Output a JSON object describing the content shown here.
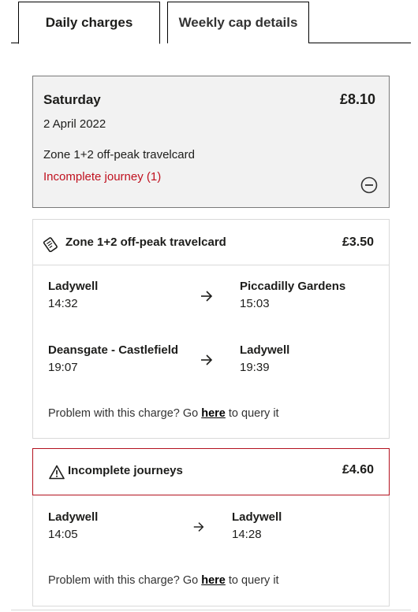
{
  "tabs": [
    {
      "label": "Daily charges",
      "active": true
    },
    {
      "label": "Weekly cap details",
      "active": false
    }
  ],
  "summary": {
    "day": "Saturday",
    "date": "2 April 2022",
    "total": "£8.10",
    "product": "Zone 1+2 off-peak travelcard",
    "incomplete_label": "Incomplete journey (1)",
    "collapse_icon": "minus-circle-icon"
  },
  "travelcard_charge": {
    "icon": "ticket-icon",
    "title": "Zone 1+2 off-peak travelcard",
    "amount": "£3.50",
    "journeys": [
      {
        "from": "Ladywell",
        "from_time": "14:32",
        "to": "Piccadilly Gardens",
        "to_time": "15:03"
      },
      {
        "from": "Deansgate - Castlefield",
        "from_time": "19:07",
        "to": "Ladywell",
        "to_time": "19:39"
      }
    ],
    "query": {
      "prefix": "Problem with this charge? Go ",
      "link": "here",
      "suffix": " to query it"
    }
  },
  "incomplete_charge": {
    "icon": "warning-icon",
    "title": "Incomplete journeys",
    "amount": "£4.60",
    "accent": "#b3111e",
    "journeys": [
      {
        "from": "Ladywell",
        "from_time": "14:05",
        "to": "Ladywell",
        "to_time": "14:28"
      }
    ],
    "query": {
      "prefix": "Problem with this charge? Go ",
      "link": "here",
      "suffix": " to query it"
    }
  },
  "colors": {
    "incomplete_text": "#c0111f",
    "summary_bg": "#f2f2f2"
  }
}
